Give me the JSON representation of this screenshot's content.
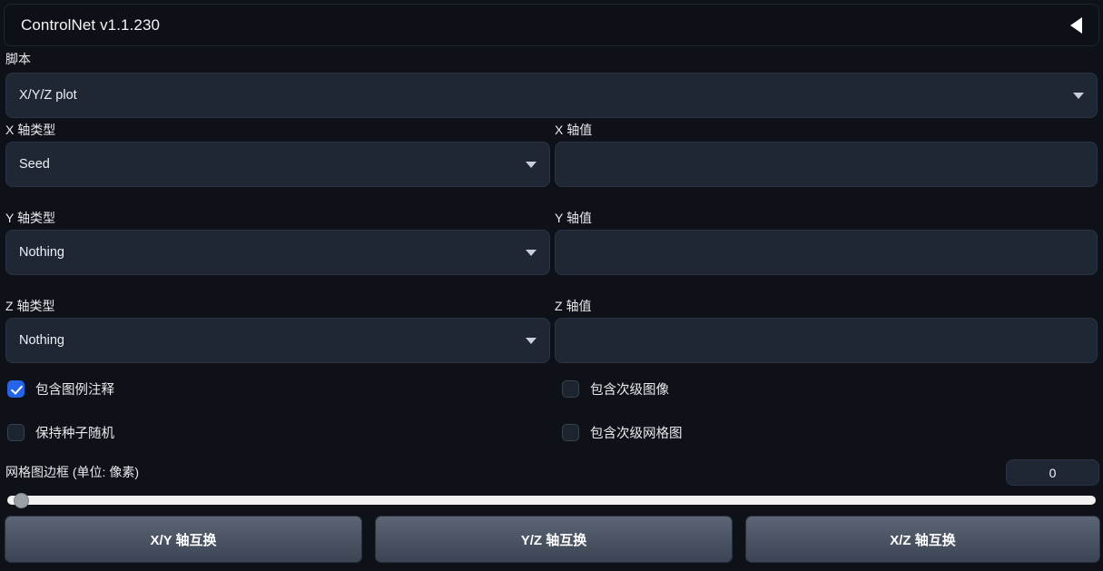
{
  "accordion": {
    "title": "ControlNet v1.1.230",
    "collapse_icon": "triangle-left-icon"
  },
  "script": {
    "label": "脚本",
    "selected": "X/Y/Z plot"
  },
  "axes": [
    {
      "type_label": "X 轴类型",
      "type_value": "Seed",
      "values_label": "X 轴值",
      "values_value": "",
      "values_placeholder": ""
    },
    {
      "type_label": "Y 轴类型",
      "type_value": "Nothing",
      "values_label": "Y 轴值",
      "values_value": "",
      "values_placeholder": ""
    },
    {
      "type_label": "Z 轴类型",
      "type_value": "Nothing",
      "values_label": "Z 轴值",
      "values_value": "",
      "values_placeholder": ""
    }
  ],
  "checkboxes": {
    "include_legend": {
      "label": "包含图例注释",
      "checked": true
    },
    "keep_seed_random": {
      "label": "保持种子随机",
      "checked": false
    },
    "include_sub_images": {
      "label": "包含次级图像",
      "checked": false
    },
    "include_sub_grids": {
      "label": "包含次级网格图",
      "checked": false
    }
  },
  "grid_margins": {
    "label": "网格图边框 (单位: 像素)",
    "value": "0",
    "min": 0,
    "max": 500,
    "fill_percent": 0
  },
  "swap_buttons": [
    {
      "label": "X/Y 轴互换"
    },
    {
      "label": "Y/Z 轴互换"
    },
    {
      "label": "X/Z 轴互换"
    }
  ],
  "colors": {
    "background": "#0e1117",
    "field_bg": "#1f2735",
    "accent_checked": "#2563eb",
    "button_gradient_top": "#5b6574",
    "button_gradient_bottom": "#3b4452",
    "slider_track": "#f2f2f2",
    "slider_thumb": "#9aa0a6"
  }
}
